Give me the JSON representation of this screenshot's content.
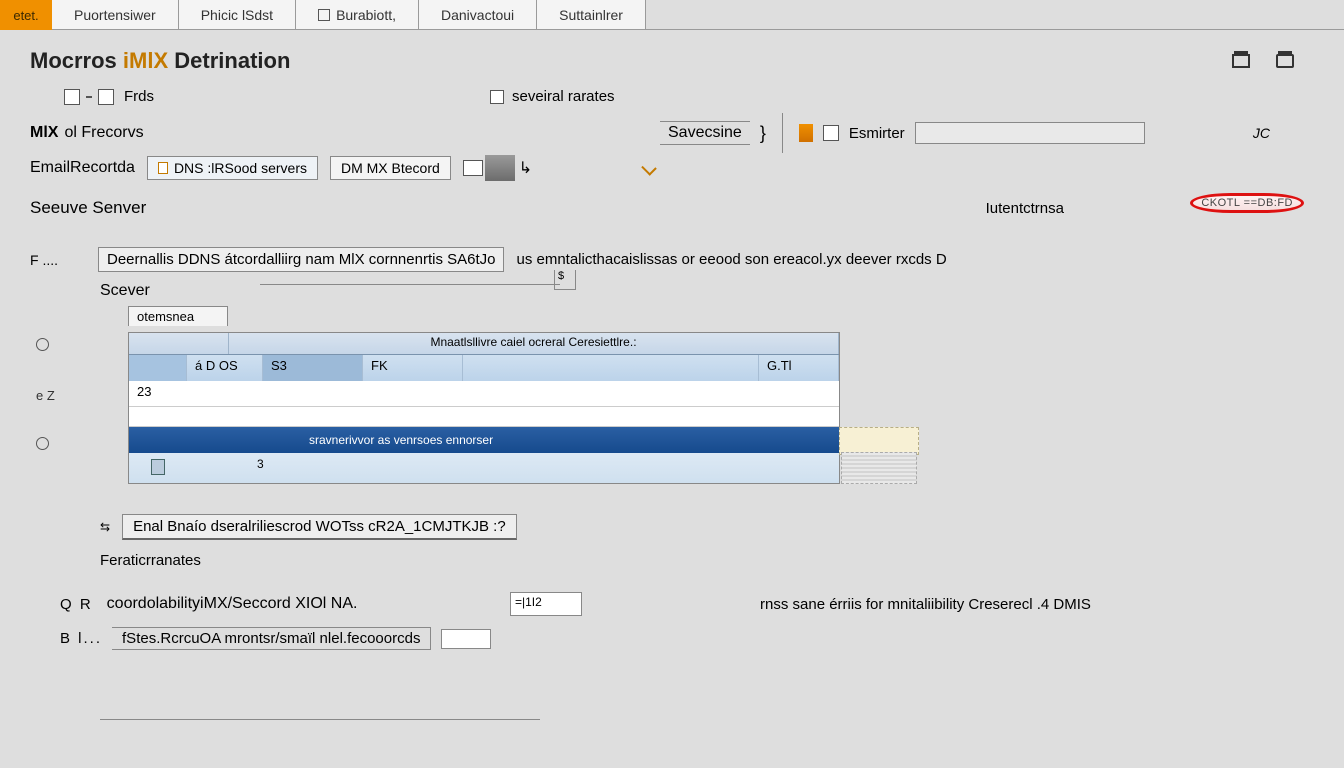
{
  "tabs": {
    "orange": "etet.",
    "t1": "Puortensiwer",
    "t2": "Phicic lSdst",
    "t3": "Burabiott,",
    "t4": "Danivactoui",
    "t5": "Suttainlrer"
  },
  "page": {
    "title_a": "Mocrros ",
    "title_b": "iMlX",
    "title_c": " Detrination"
  },
  "toolrow": {
    "label": "Frds",
    "checkbox_label": "seveiral rarates"
  },
  "row_a": {
    "mx": "MlX",
    "rest": " ol Frecorvs",
    "save_btn": "Savecsine",
    "smiter": "Esmirter",
    "jc": "JC"
  },
  "row_b": {
    "label": "EmailRecortda",
    "box1": "DNS :lRSood servers",
    "box2": "DM MX Btecord"
  },
  "row_c": {
    "label": "Seeuve Senver",
    "ident": "Iutentctrnsa",
    "badge": "CKOTL ==DB:FD"
  },
  "tiny_s": "$",
  "row_d": {
    "f": "F ....",
    "box": "Deernallis DDNS átcordalliirg nam MlX cornnenrtis SA6tJo",
    "trail": "us emntalicthacaislissas or eeood son ereacol.yx deever  rxcds  D"
  },
  "row_e": "Scever",
  "grid": {
    "tab": "otemsnea",
    "head": "Mnaatlsllivre  caiel ocreral    Ceresiettlre.:",
    "r1_a": "",
    "r1_b": "á D OS",
    "r1_c": "S3",
    "r1_d": "FK",
    "r1_f": "G.Tl",
    "r2_a": "23",
    "sel": "sravnerivvor as venrsoes ennorser",
    "row3_num": "3"
  },
  "row_f": {
    "box": "Enal Bnaío dseralriliescrod WOTss cR2A_1CMJTKJB :?"
  },
  "row_g": "Feraticrranates",
  "row_h": {
    "lead": "Q  R",
    "main": "coordolabilityiMX/Seccord XIOl NA.",
    "box": "=|1I2",
    "trail": "rnss sane érriis for mnitaliibility Creserecl .4 DMIS"
  },
  "row_i": {
    "lead": "B  l...",
    "main": "fStes.RcrcuOA mrontsr/smaïl nlel.fecooorcds"
  },
  "col_markers": {
    "a": "e",
    "b": "e  Z",
    "c": "e"
  }
}
